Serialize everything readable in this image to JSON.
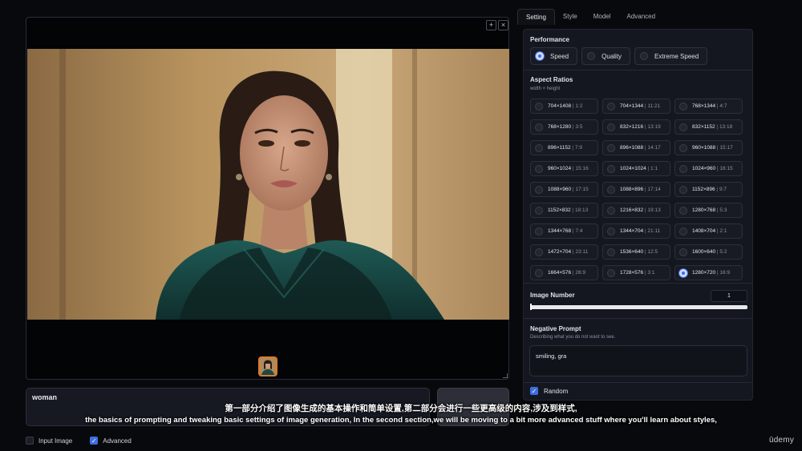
{
  "gallery": {
    "btn_add": "+",
    "btn_close": "×"
  },
  "prompt": {
    "value": "woman"
  },
  "bottom_options": [
    {
      "label": "Input Image",
      "checked": false
    },
    {
      "label": "Advanced",
      "checked": true
    }
  ],
  "tabs": [
    "Setting",
    "Style",
    "Model",
    "Advanced"
  ],
  "performance": {
    "title": "Performance",
    "options": [
      {
        "label": "Speed",
        "selected": true
      },
      {
        "label": "Quality",
        "selected": false
      },
      {
        "label": "Extreme Speed",
        "selected": false
      }
    ]
  },
  "aspect_ratios": {
    "title": "Aspect Ratios",
    "subtitle": "width × height",
    "items": [
      {
        "size": "704×1408",
        "ratio": "1:2",
        "selected": false
      },
      {
        "size": "704×1344",
        "ratio": "11:21",
        "selected": false
      },
      {
        "size": "768×1344",
        "ratio": "4:7",
        "selected": false
      },
      {
        "size": "768×1280",
        "ratio": "3:5",
        "selected": false
      },
      {
        "size": "832×1216",
        "ratio": "13:19",
        "selected": false
      },
      {
        "size": "832×1152",
        "ratio": "13:18",
        "selected": false
      },
      {
        "size": "896×1152",
        "ratio": "7:9",
        "selected": false
      },
      {
        "size": "896×1088",
        "ratio": "14:17",
        "selected": false
      },
      {
        "size": "960×1088",
        "ratio": "15:17",
        "selected": false
      },
      {
        "size": "960×1024",
        "ratio": "15:16",
        "selected": false
      },
      {
        "size": "1024×1024",
        "ratio": "1:1",
        "selected": false
      },
      {
        "size": "1024×960",
        "ratio": "16:15",
        "selected": false
      },
      {
        "size": "1088×960",
        "ratio": "17:15",
        "selected": false
      },
      {
        "size": "1088×896",
        "ratio": "17:14",
        "selected": false
      },
      {
        "size": "1152×896",
        "ratio": "9:7",
        "selected": false
      },
      {
        "size": "1152×832",
        "ratio": "18:13",
        "selected": false
      },
      {
        "size": "1216×832",
        "ratio": "19:13",
        "selected": false
      },
      {
        "size": "1280×768",
        "ratio": "5:3",
        "selected": false
      },
      {
        "size": "1344×768",
        "ratio": "7:4",
        "selected": false
      },
      {
        "size": "1344×704",
        "ratio": "21:11",
        "selected": false
      },
      {
        "size": "1408×704",
        "ratio": "2:1",
        "selected": false
      },
      {
        "size": "1472×704",
        "ratio": "23:11",
        "selected": false
      },
      {
        "size": "1536×640",
        "ratio": "12:5",
        "selected": false
      },
      {
        "size": "1600×640",
        "ratio": "5:2",
        "selected": false
      },
      {
        "size": "1664×576",
        "ratio": "26:9",
        "selected": false
      },
      {
        "size": "1728×576",
        "ratio": "3:1",
        "selected": false
      },
      {
        "size": "1280×720",
        "ratio": "16:9",
        "selected": true
      }
    ]
  },
  "image_number": {
    "title": "Image Number",
    "value": "1",
    "slider_fraction": 0
  },
  "negative_prompt": {
    "title": "Negative Prompt",
    "subtitle": "Describing what you do not want to see.",
    "value": "smiling, gra"
  },
  "random": {
    "label": "Random",
    "checked": true
  },
  "subtitles": {
    "zh": "第一部分介绍了图像生成的基本操作和简单设置,第二部分会进行一些更高级的内容,涉及到样式,",
    "en": "the basics of prompting and tweaking basic settings of image generation, In the second section,we will be moving to a bit more advanced stuff where you'll learn about styles,"
  },
  "brand": "ūdemy",
  "colors": {
    "accent": "#3d6fe0",
    "thumb_border": "#d87c2e",
    "panel_bg": "#141720",
    "page_bg": "#08090d"
  }
}
